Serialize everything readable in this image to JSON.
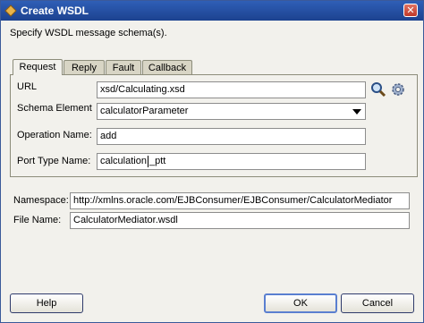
{
  "window": {
    "title": "Create WSDL",
    "close_glyph": "✕"
  },
  "instruction": "Specify WSDL message schema(s).",
  "tabs": [
    {
      "label": "Request",
      "active": true
    },
    {
      "label": "Reply",
      "active": false
    },
    {
      "label": "Fault",
      "active": false
    },
    {
      "label": "Callback",
      "active": false
    }
  ],
  "request": {
    "url_label": "URL",
    "url_value": "xsd/Calculating.xsd",
    "schema_element_label": "Schema Element",
    "schema_element_value": "calculatorParameter",
    "operation_name_label": "Operation Name:",
    "operation_name_value": "add",
    "port_type_label": "Port Type Name:",
    "port_type_value_before_caret": "calculation",
    "port_type_value_after_caret": "_ptt"
  },
  "namespace": {
    "label": "Namespace:",
    "value": "http://xmlns.oracle.com/EJBConsumer/EJBConsumer/CalculatorMediator"
  },
  "file_name": {
    "label": "File Name:",
    "value": "CalculatorMediator.wsdl"
  },
  "buttons": {
    "help": "Help",
    "ok": "OK",
    "cancel": "Cancel"
  },
  "icons": {
    "title": "wsdl-app-icon",
    "browse": "search-icon",
    "settings": "gear-icon"
  }
}
